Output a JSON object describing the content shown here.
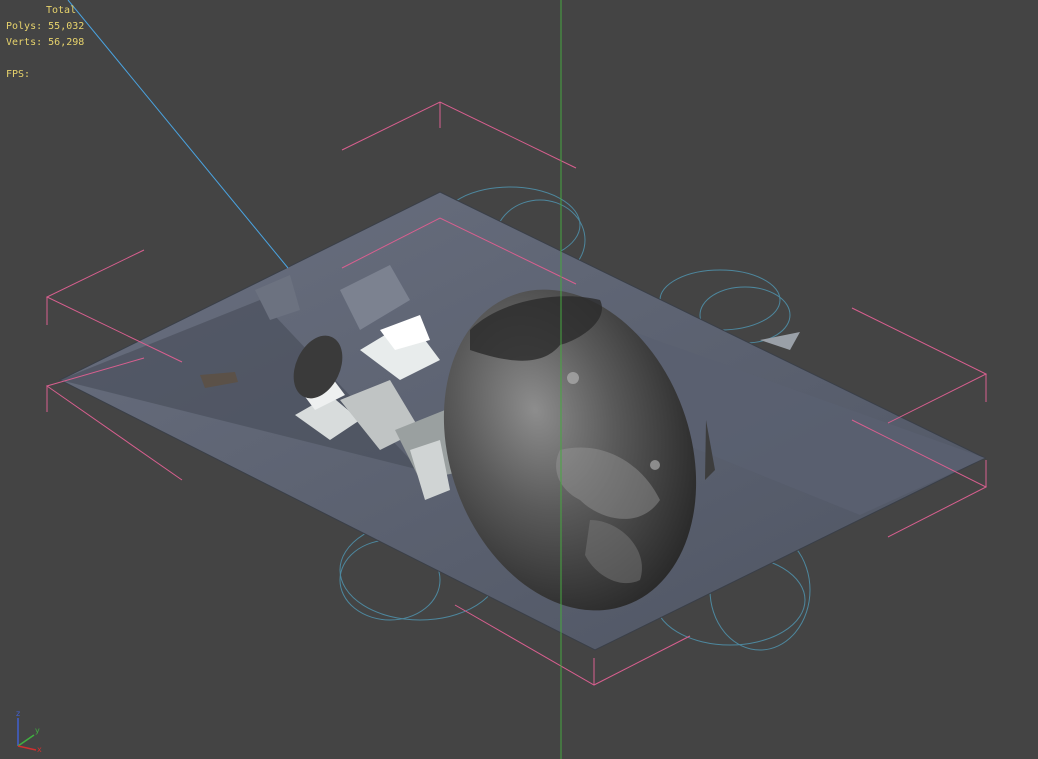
{
  "stats": {
    "header": "Total",
    "polys_label": "Polys:",
    "polys_value": "55,032",
    "verts_label": "Verts:",
    "verts_value": "56,298",
    "fps_label": "FPS:",
    "fps_value": ""
  },
  "axis_gizmo": {
    "z_label": "z",
    "y_label": "y",
    "x_label": "x"
  },
  "colors": {
    "viewport_bg": "#444444",
    "stats_text": "#e7d36c",
    "bounding_box": "#d85f8f",
    "vertical_axis": "#46a83f",
    "light_line": "#4aa3e0",
    "helper_circles": "#4f8fa8",
    "ground": "#5c6270",
    "axis_z": "#4060d0",
    "axis_y": "#40b040",
    "axis_x": "#d03030"
  },
  "scene": {
    "objects": [
      "ground-plane",
      "boulder",
      "debris",
      "bounding-box",
      "helper-circles"
    ]
  }
}
